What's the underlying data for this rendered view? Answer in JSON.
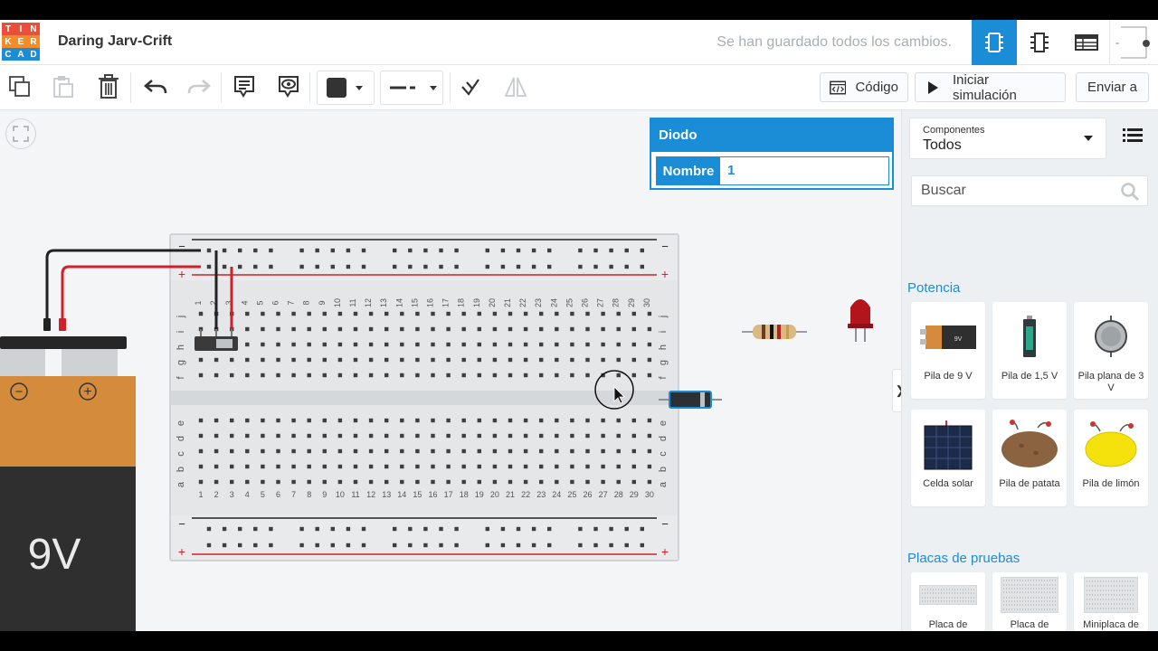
{
  "header": {
    "logo_letters": [
      "T",
      "I",
      "N",
      "K",
      "E",
      "R",
      "C",
      "A",
      "D"
    ],
    "logo_colors": [
      "#e8503a",
      "#e8503a",
      "#e8503a",
      "#f28c28",
      "#f28c28",
      "#f28c28",
      "#1a8dd6",
      "#1a8dd6",
      "#1a8dd6"
    ],
    "project_title": "Daring Jarv-Crift",
    "save_status": "Se han guardado todos los cambios.",
    "views": [
      "circuit-view-icon",
      "schematic-view-icon",
      "component-list-icon"
    ]
  },
  "toolbar": {
    "tools": [
      "copy-icon",
      "paste-icon",
      "delete-icon",
      "undo-icon",
      "redo-icon",
      "note-icon",
      "note-visibility-icon",
      "fill-color-dropdown",
      "line-style-dropdown",
      "flip-icon",
      "mirror-icon"
    ],
    "code_label": "Código",
    "simulate_label": "Iniciar simulación",
    "send_label": "Enviar a"
  },
  "inspector": {
    "title": "Diodo",
    "field_label": "Nombre",
    "field_value": "1"
  },
  "breadboard": {
    "rail_minus": "−",
    "rail_plus": "+",
    "columns": [
      "1",
      "2",
      "3",
      "4",
      "5",
      "6",
      "7",
      "8",
      "9",
      "10",
      "11",
      "12",
      "13",
      "14",
      "15",
      "16",
      "17",
      "18",
      "19",
      "20",
      "21",
      "22",
      "23",
      "24",
      "25",
      "26",
      "27",
      "28",
      "29",
      "30"
    ],
    "rows_top": [
      "j",
      "i",
      "h",
      "g",
      "f"
    ],
    "rows_bottom": [
      "e",
      "d",
      "c",
      "b",
      "a"
    ]
  },
  "battery": {
    "label": "9V",
    "minus": "−",
    "plus": "+"
  },
  "panel": {
    "select_label": "Componentes",
    "select_value": "Todos",
    "search_placeholder": "Buscar",
    "sections": [
      {
        "title": "Potencia",
        "items": [
          {
            "label": "Pila de 9 V",
            "badge": "9V"
          },
          {
            "label": "Pila de 1,5 V"
          },
          {
            "label": "Pila plana de 3 V"
          },
          {
            "label": "Celda solar"
          },
          {
            "label": "Pila de patata"
          },
          {
            "label": "Pila de limón"
          }
        ]
      },
      {
        "title": "Placas de pruebas",
        "items": [
          {
            "label": "Placa de"
          },
          {
            "label": "Placa de"
          },
          {
            "label": "Miniplaca de"
          }
        ]
      }
    ],
    "collapse_glyph": "❯"
  },
  "colors": {
    "accent": "#1a8dd6",
    "wire_red": "#d0212b",
    "wire_black": "#222222",
    "battery_top": "#d48b3c",
    "battery_body": "#2f2f2f"
  }
}
